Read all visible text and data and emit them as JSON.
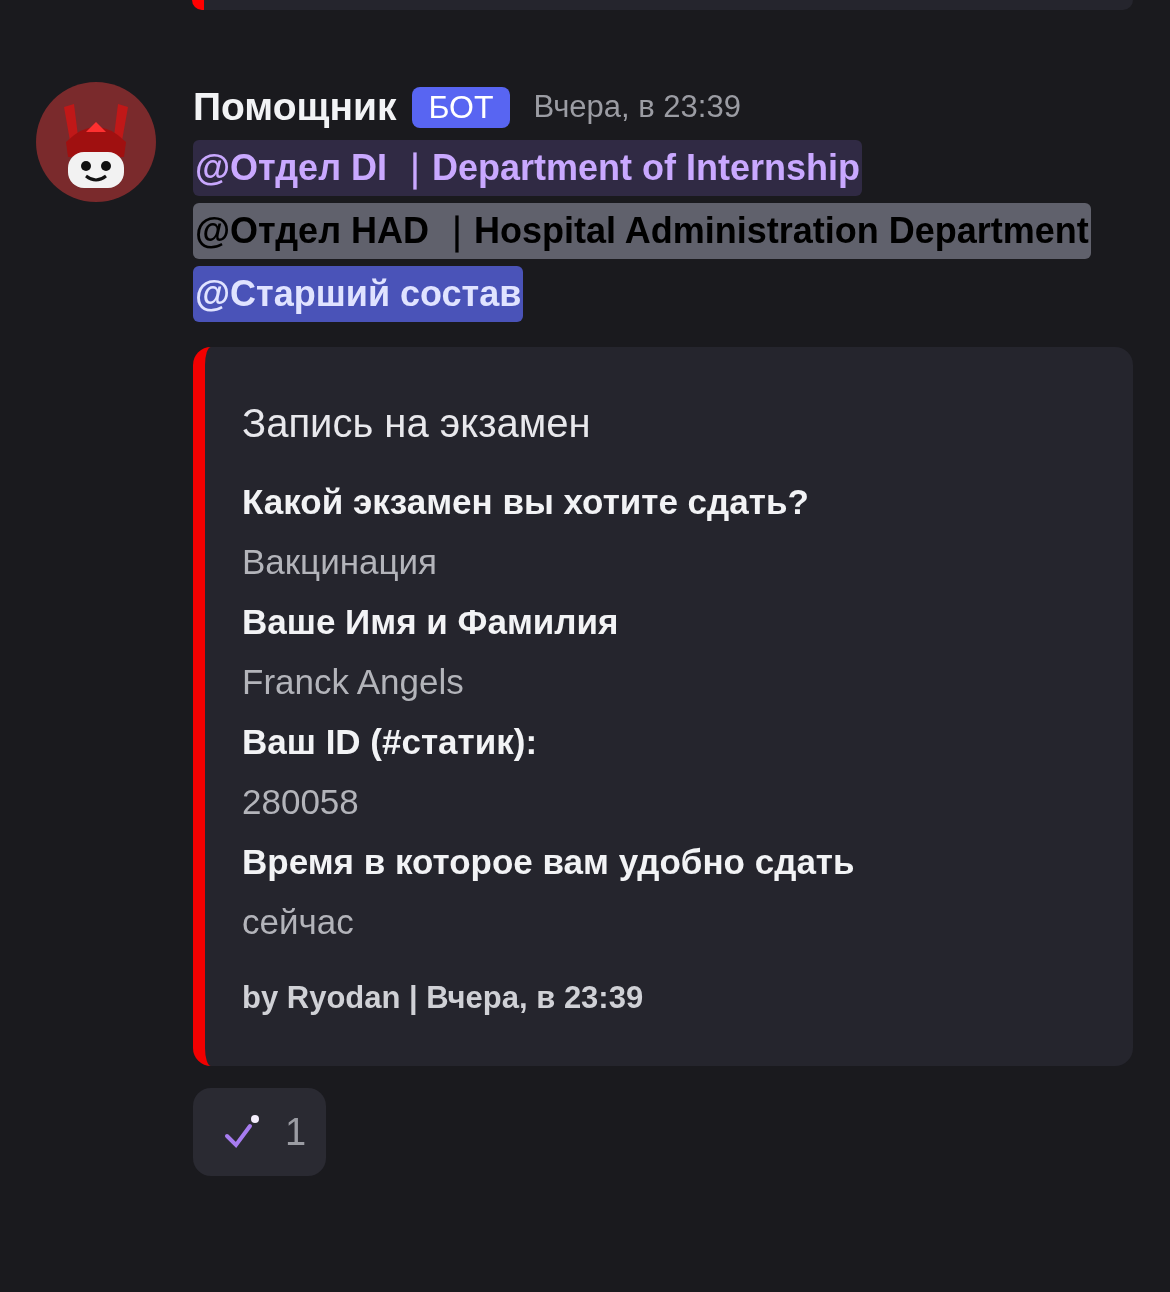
{
  "message": {
    "author": "Помощник",
    "badge": "БОТ",
    "timestamp": "Вчера, в 23:39",
    "mentions": [
      {
        "text": "@Отдел DI ｜Department of Internship",
        "kind": "tinted",
        "highlighted": false
      },
      {
        "text": "@Отдел HAD ｜Hospital Administration Department",
        "kind": "dark",
        "highlighted": false
      },
      {
        "text": "@Старший состав",
        "kind": "tinted",
        "highlighted": true
      }
    ],
    "embed": {
      "title": "Запись на экзамен",
      "fields": [
        {
          "name": "Какой экзамен вы хотите сдать?",
          "value": "Вакцинация"
        },
        {
          "name": "Ваше Имя и Фамилия",
          "value": "Franck Angels"
        },
        {
          "name": "Ваш ID (#статик):",
          "value": "280058"
        },
        {
          "name": "Время в которое вам удобно сдать",
          "value": "сейчас"
        }
      ],
      "footer": "by Ryodan | Вчера, в 23:39"
    },
    "reactions": [
      {
        "count": "1"
      }
    ]
  }
}
